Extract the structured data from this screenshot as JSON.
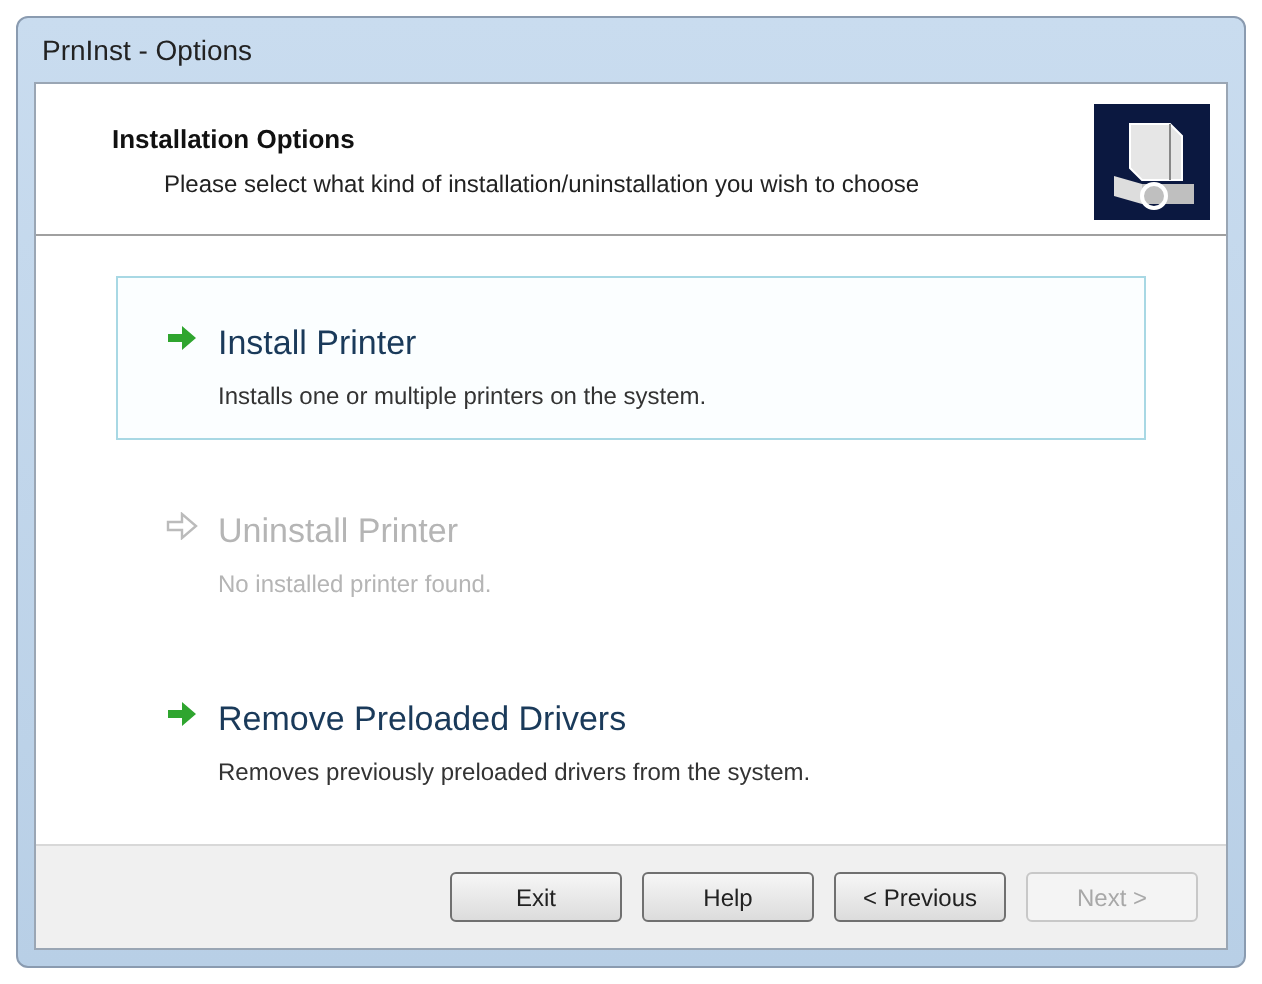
{
  "window": {
    "title": "PrnInst - Options"
  },
  "header": {
    "title": "Installation Options",
    "subtitle": "Please select what kind of installation/uninstallation you wish to choose"
  },
  "options": [
    {
      "title": "Install Printer",
      "description": "Installs one or multiple printers on the system.",
      "selected": true,
      "disabled": false
    },
    {
      "title": "Uninstall Printer",
      "description": "No installed printer found.",
      "selected": false,
      "disabled": true
    },
    {
      "title": "Remove Preloaded Drivers",
      "description": "Removes previously preloaded drivers from the system.",
      "selected": false,
      "disabled": false
    }
  ],
  "buttons": [
    {
      "label": "Exit",
      "disabled": false
    },
    {
      "label": "Help",
      "disabled": false
    },
    {
      "label": "< Previous",
      "disabled": false
    },
    {
      "label": "Next >",
      "disabled": true
    }
  ]
}
